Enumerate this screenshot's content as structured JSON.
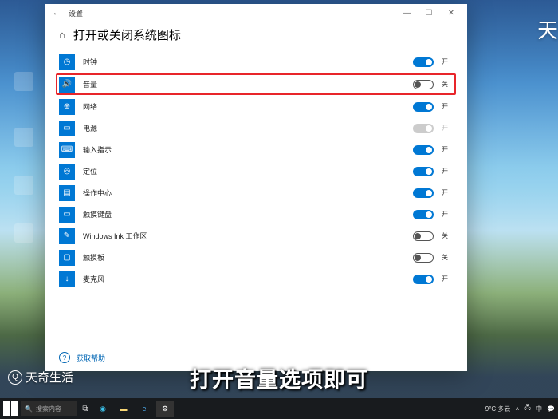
{
  "watermark_top": "天",
  "brand": "天奇生活",
  "caption": "打开音量选项即可",
  "window": {
    "app_name": "设置",
    "title": "打开或关闭系统图标",
    "help_link": "获取帮助"
  },
  "items": [
    {
      "icon": "clock-icon",
      "label": "时钟",
      "state": "on",
      "state_label": "开",
      "highlight": false
    },
    {
      "icon": "volume-icon",
      "label": "音量",
      "state": "off",
      "state_label": "关",
      "highlight": true
    },
    {
      "icon": "network-icon",
      "label": "网络",
      "state": "on",
      "state_label": "开",
      "highlight": false
    },
    {
      "icon": "power-icon",
      "label": "电源",
      "state": "disabled",
      "state_label": "开",
      "highlight": false
    },
    {
      "icon": "ime-icon",
      "label": "输入指示",
      "state": "on",
      "state_label": "开",
      "highlight": false
    },
    {
      "icon": "location-icon",
      "label": "定位",
      "state": "on",
      "state_label": "开",
      "highlight": false
    },
    {
      "icon": "action-icon",
      "label": "操作中心",
      "state": "on",
      "state_label": "开",
      "highlight": false
    },
    {
      "icon": "keyboard-icon",
      "label": "触摸键盘",
      "state": "on",
      "state_label": "开",
      "highlight": false
    },
    {
      "icon": "ink-icon",
      "label": "Windows Ink 工作区",
      "state": "off",
      "state_label": "关",
      "highlight": false
    },
    {
      "icon": "touchpad-icon",
      "label": "触摸板",
      "state": "off",
      "state_label": "关",
      "highlight": false
    },
    {
      "icon": "mic-icon",
      "label": "麦克风",
      "state": "on",
      "state_label": "开",
      "highlight": false
    }
  ],
  "taskbar": {
    "search_placeholder": "搜索内容",
    "weather": "9°C 多云",
    "clock": ""
  },
  "icon_glyphs": {
    "clock-icon": "◷",
    "volume-icon": "🔊",
    "network-icon": "⊕",
    "power-icon": "▭",
    "ime-icon": "⌨",
    "location-icon": "◎",
    "action-icon": "▤",
    "keyboard-icon": "▭",
    "ink-icon": "✎",
    "touchpad-icon": "▢",
    "mic-icon": "↓"
  }
}
